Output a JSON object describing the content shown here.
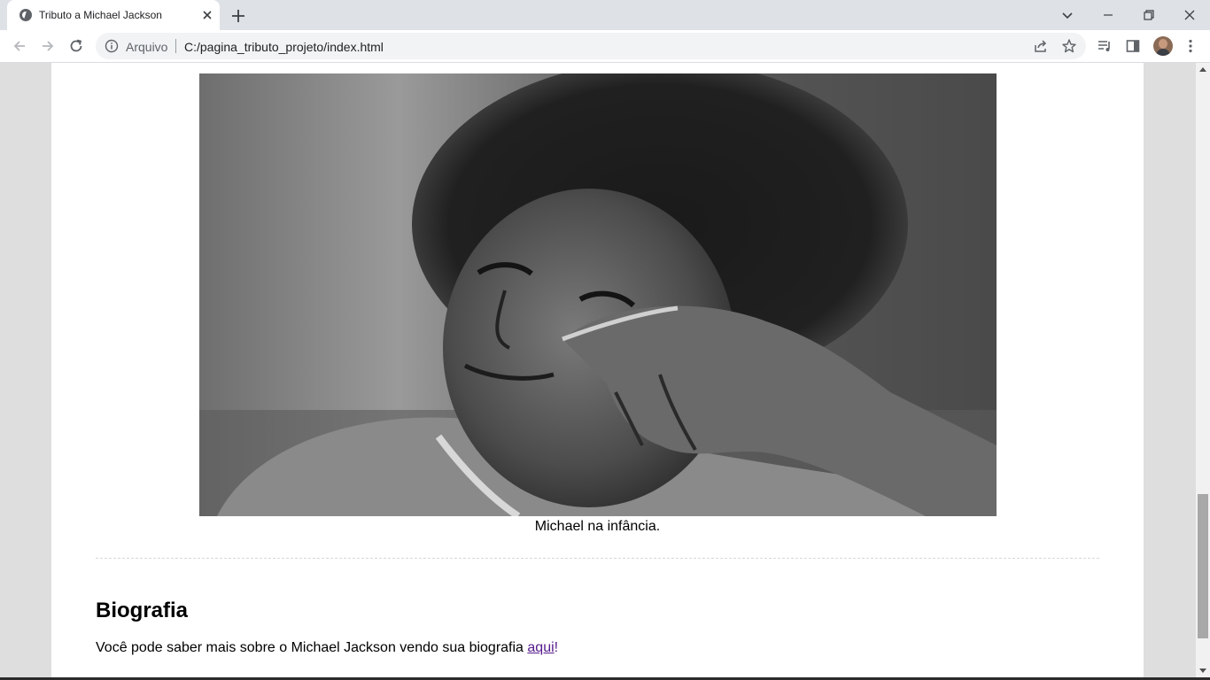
{
  "browser": {
    "tab": {
      "title": "Tributo a Michael Jackson",
      "favicon": "globe-icon"
    },
    "omnibox": {
      "scheme_label": "Arquivo",
      "url": "C:/pagina_tributo_projeto/index.html"
    },
    "icons": {
      "back": "arrow-left-icon",
      "forward": "arrow-right-icon",
      "reload": "reload-icon",
      "info": "info-icon",
      "share": "share-icon",
      "bookmark": "star-icon",
      "media": "media-queue-icon",
      "side_panel": "side-panel-icon",
      "menu": "kebab-menu-icon",
      "new_tab": "plus-icon",
      "tab_search": "chevron-down-icon",
      "minimize": "minimize-icon",
      "restore": "restore-icon",
      "close": "close-icon"
    }
  },
  "page": {
    "image": {
      "description_icon": "photo-young-michael-jackson"
    },
    "caption": "Michael na infância.",
    "biography": {
      "heading": "Biografia",
      "text": "Você pode saber mais sobre o Michael Jackson vendo sua biografia ",
      "link_text": "aqui",
      "suffix": "!"
    }
  },
  "colors": {
    "chrome_frame": "#dee1e6",
    "page_background": "#dedede",
    "content_background": "#ffffff",
    "visited_link": "#551a8b"
  },
  "scrollbar": {
    "position_fraction": 0.92
  }
}
